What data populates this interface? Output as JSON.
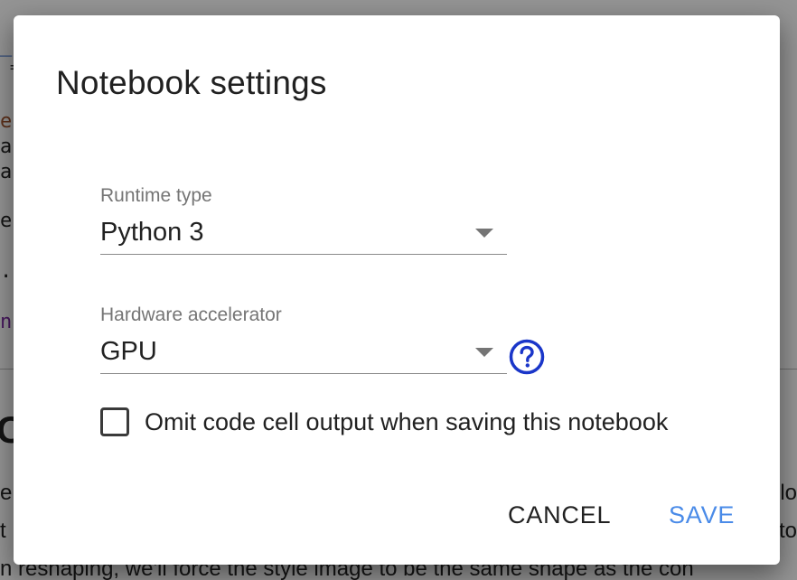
{
  "dialog": {
    "title": "Notebook settings",
    "runtime": {
      "label": "Runtime type",
      "value": "Python 3"
    },
    "hardware": {
      "label": "Hardware accelerator",
      "value": "GPU"
    },
    "help_icon": "question-circle-icon",
    "omit_output": {
      "label": "Omit code cell output when saving this notebook",
      "checked": false
    },
    "buttons": {
      "cancel": "CANCEL",
      "save": "SAVE"
    }
  },
  "background": {
    "paragraph_fragment": "n reshaping, we'll force the style image to be the same shape as the con"
  },
  "colors": {
    "accent": "#4a8be8",
    "help_icon": "#1a36c9",
    "overlay": "#6f6f6f"
  }
}
